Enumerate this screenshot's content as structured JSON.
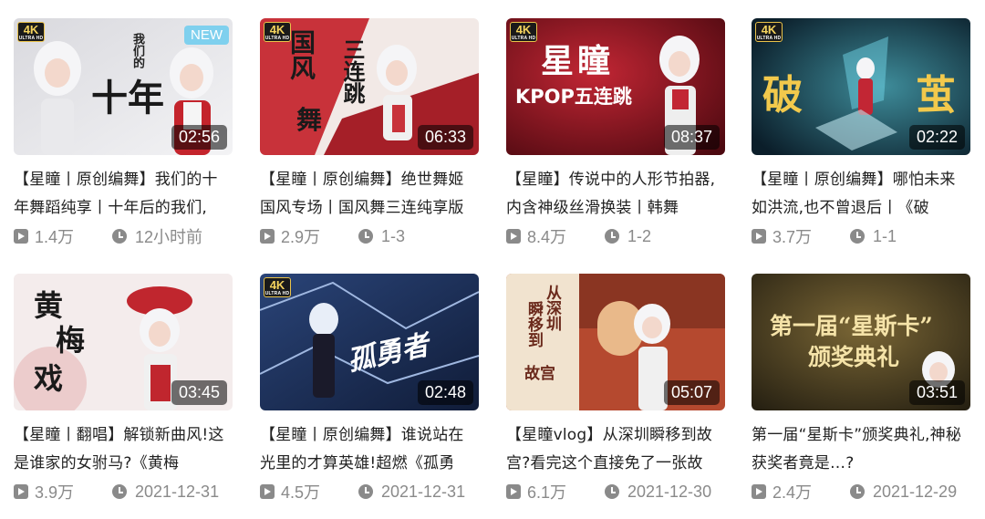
{
  "badge_4k": "4K",
  "badge_4k_sub": "ULTRA HD",
  "new_tag": "NEW",
  "videos": [
    {
      "title": "【星瞳丨原创编舞】我们的十年舞蹈纯享丨十年后的我们,",
      "duration": "02:56",
      "views": "1.4万",
      "date": "12小时前",
      "overlay": [
        "我们的",
        "十年"
      ],
      "has_4k": true,
      "has_new": true,
      "colors": [
        "#d9d9de",
        "#efeff2"
      ]
    },
    {
      "title": "【星瞳丨原创编舞】绝世舞姬国风专场丨国风舞三连纯享版",
      "duration": "06:33",
      "views": "2.9万",
      "date": "1-3",
      "overlay": [
        "国风",
        "舞",
        "三连跳"
      ],
      "has_4k": true,
      "has_new": false,
      "colors": [
        "#c8323a",
        "#f2e9e6"
      ]
    },
    {
      "title": "【星瞳】传说中的人形节拍器,内含神级丝滑换装丨韩舞",
      "duration": "08:37",
      "views": "8.4万",
      "date": "1-2",
      "overlay": [
        "星瞳",
        "KPOP五连跳"
      ],
      "has_4k": true,
      "has_new": false,
      "colors": [
        "#b21f2d",
        "#5a0b14"
      ]
    },
    {
      "title": "【星瞳丨原创编舞】哪怕未来如洪流,也不曾退后丨《破",
      "duration": "02:22",
      "views": "3.7万",
      "date": "1-1",
      "overlay": [
        "破",
        "茧"
      ],
      "has_4k": true,
      "has_new": false,
      "colors": [
        "#0f2a3a",
        "#2a6b7a"
      ]
    },
    {
      "title": "【星瞳丨翻唱】解锁新曲风!这是谁家的女驸马?《黄梅",
      "duration": "03:45",
      "views": "3.9万",
      "date": "2021-12-31",
      "overlay": [
        "黄",
        "梅",
        "戏"
      ],
      "has_4k": false,
      "has_new": false,
      "colors": [
        "#c0262e",
        "#f4ecec"
      ]
    },
    {
      "title": "【星瞳丨原创编舞】谁说站在光里的才算英雄!超燃《孤勇",
      "duration": "02:48",
      "views": "4.5万",
      "date": "2021-12-31",
      "overlay": [
        "孤勇者"
      ],
      "has_4k": true,
      "has_new": false,
      "colors": [
        "#1b2f5a",
        "#4a6fa8"
      ]
    },
    {
      "title": "【星瞳vlog】从深圳瞬移到故宫?看完这个直接免了一张故",
      "duration": "05:07",
      "views": "6.1万",
      "date": "2021-12-30",
      "overlay": [
        "从深圳",
        "瞬移到",
        "故宫"
      ],
      "has_4k": false,
      "has_new": false,
      "colors": [
        "#f1e3cf",
        "#b5492f"
      ]
    },
    {
      "title": "第一届“星斯卡”颁奖典礼,神秘获奖者竟是…?",
      "duration": "03:51",
      "views": "2.4万",
      "date": "2021-12-29",
      "overlay": [
        "第一届“星斯卡”",
        "颁奖典礼"
      ],
      "has_4k": false,
      "has_new": false,
      "colors": [
        "#2c2616",
        "#6b5a30"
      ]
    }
  ]
}
